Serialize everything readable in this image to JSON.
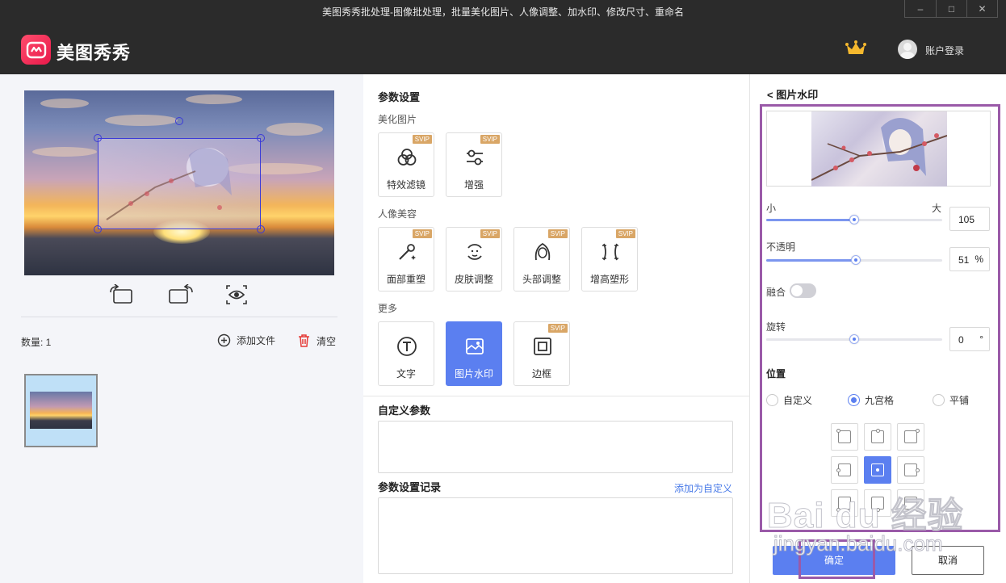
{
  "window": {
    "title": "美图秀秀批处理-图像批处理，批量美化图片、人像调整、加水印、修改尺寸、重命名",
    "minimize": "–",
    "restore": "□",
    "close": "✕"
  },
  "header": {
    "brand": "美图秀秀",
    "login": "账户登录",
    "crown_icon": "crown-icon"
  },
  "left": {
    "count_label": "数量:  1",
    "add_file": "添加文件",
    "clear": "清空"
  },
  "middle": {
    "params_title": "参数设置",
    "beautify_label": "美化图片",
    "portrait_label": "人像美容",
    "more_label": "更多",
    "svip": "SVIP",
    "beautify_cards": [
      {
        "label": "特效滤镜",
        "svip": true
      },
      {
        "label": "增强",
        "svip": true
      }
    ],
    "portrait_cards": [
      {
        "label": "面部重塑",
        "svip": true
      },
      {
        "label": "皮肤调整",
        "svip": true
      },
      {
        "label": "头部调整",
        "svip": true
      },
      {
        "label": "增高塑形",
        "svip": true
      }
    ],
    "more_cards": [
      {
        "label": "文字",
        "svip": false
      },
      {
        "label": "图片水印",
        "svip": false,
        "active": true
      },
      {
        "label": "边框",
        "svip": true
      }
    ],
    "custom_params_title": "自定义参数",
    "history_title": "参数设置记录",
    "add_custom": "添加为自定义"
  },
  "right": {
    "back_title": "< 图片水印",
    "size_small": "小",
    "size_large": "大",
    "size_value": "105",
    "size_level": 0.5,
    "opacity_label": "不透明",
    "opacity_value": "51",
    "opacity_unit": "%",
    "opacity_level": 0.51,
    "blend_label": "融合",
    "blend_on": false,
    "rotate_label": "旋转",
    "rotate_value": "0",
    "rotate_unit": "°",
    "rotate_level": 0.5,
    "position_label": "位置",
    "position_options": [
      "自定义",
      "九宫格",
      "平铺"
    ],
    "position_selected": "九宫格",
    "grid_selected": "center",
    "ok": "确定",
    "cancel": "取消"
  },
  "watermark": {
    "line1": "Bai du 经验",
    "line2": "jingyan.baidu.com"
  },
  "colors": {
    "accent": "#5b7ff0",
    "header_bg": "#2b2b2b",
    "svip_badge": "#d9a666",
    "highlight_border": "#9a5aa8"
  }
}
